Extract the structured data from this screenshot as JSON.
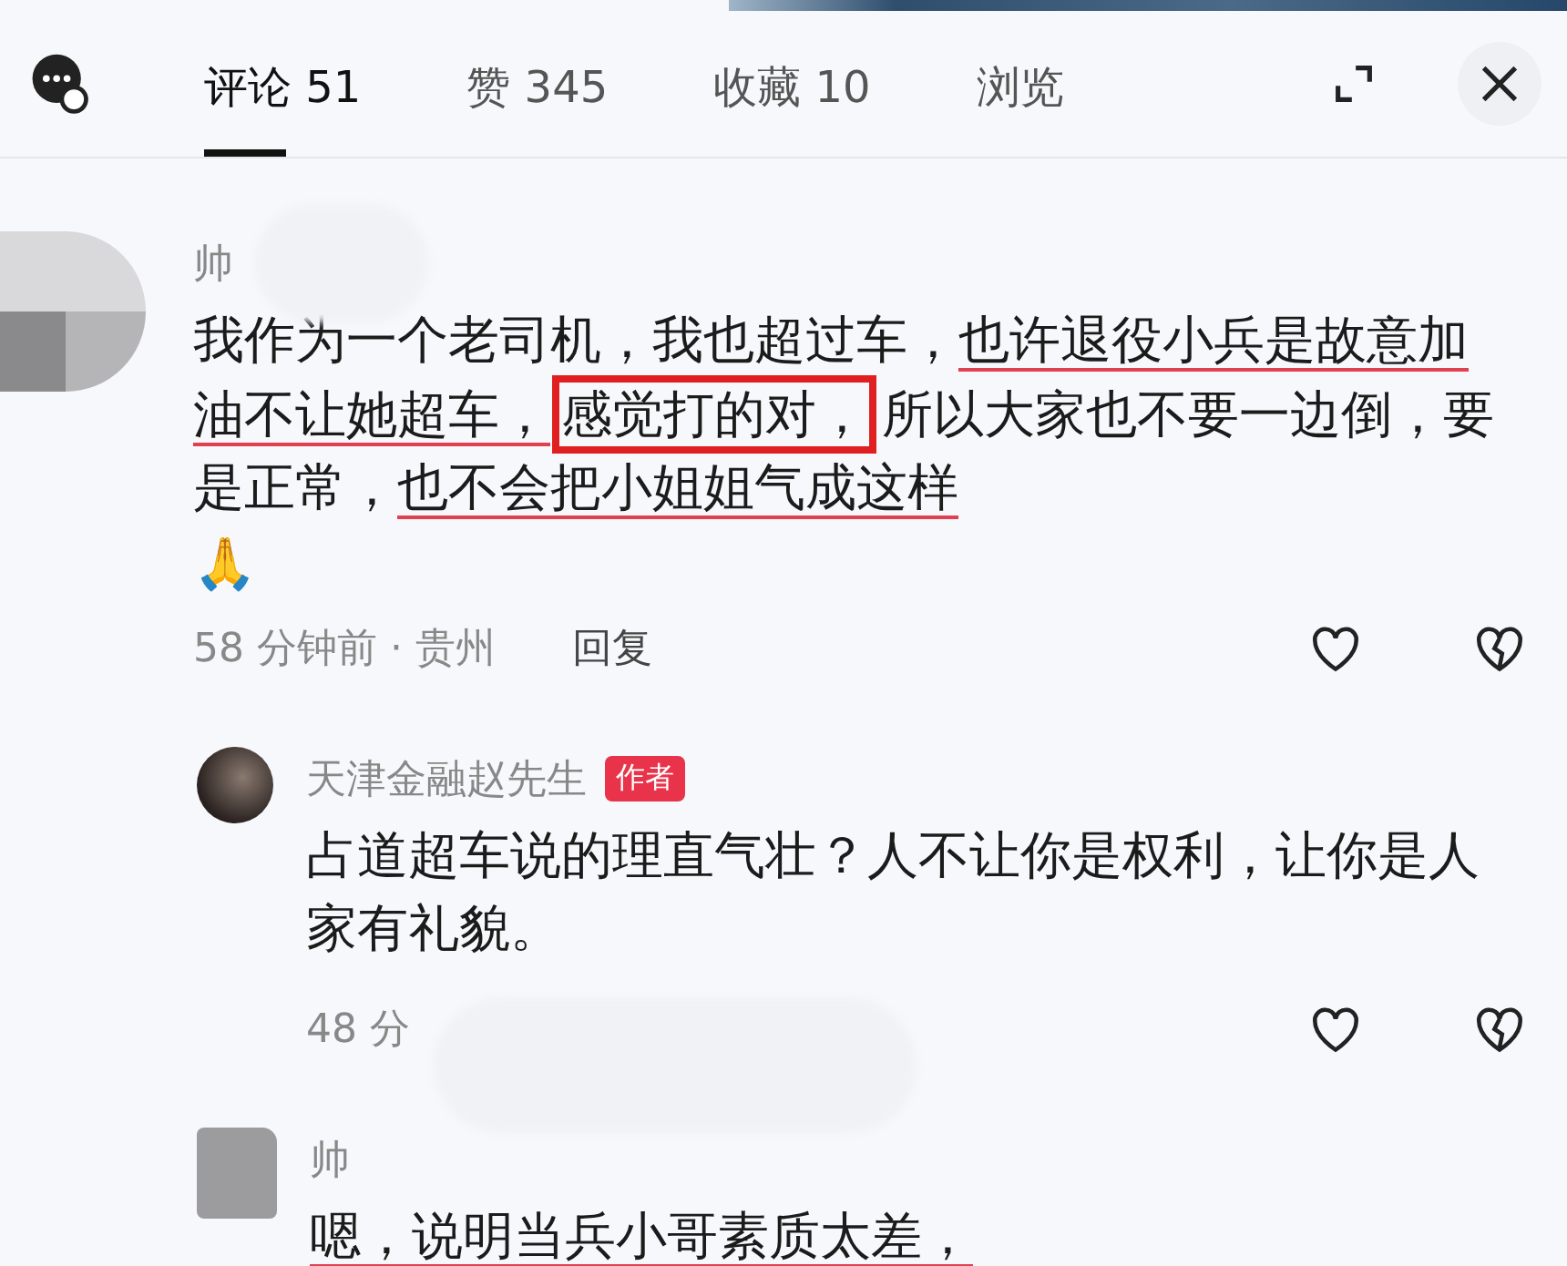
{
  "tabs": [
    {
      "label": "评论 51",
      "selected": true
    },
    {
      "label": "赞 345",
      "selected": false
    },
    {
      "label": "收藏 10",
      "selected": false
    },
    {
      "label": "浏览",
      "selected": false
    }
  ],
  "comments": [
    {
      "author": "帅",
      "avatar": {
        "kind": "mosaic"
      },
      "nested": false,
      "segments": [
        {
          "text": "我作为一个老司机，我也超过车，",
          "kind": "plain"
        },
        {
          "text": "也许退役小兵是故意加油不让她超车，",
          "kind": "underline"
        },
        {
          "text": "感觉打的对，",
          "kind": "box"
        },
        {
          "text": "所以大家也不要一边倒，要是正常，",
          "kind": "plain"
        },
        {
          "text": "也不会把小姐姐气成这样",
          "kind": "underline"
        }
      ],
      "emoji": "🙏",
      "time": "58 分钟前 · 贵州",
      "reply": "回复"
    },
    {
      "author": "天津金融赵先生",
      "author_badge": "作者",
      "avatar": {
        "kind": "photo"
      },
      "nested": true,
      "segments": [
        {
          "text": "占道超车说的理直气壮？人不让你是权利，让你是人家有礼貌。",
          "kind": "plain"
        }
      ],
      "time": "48 分"
    },
    {
      "author": "帅",
      "avatar": {
        "kind": "square"
      },
      "nested": true,
      "segments": [
        {
          "text": "嗯，说明当兵小哥素质太差，",
          "kind": "underline"
        }
      ]
    }
  ]
}
